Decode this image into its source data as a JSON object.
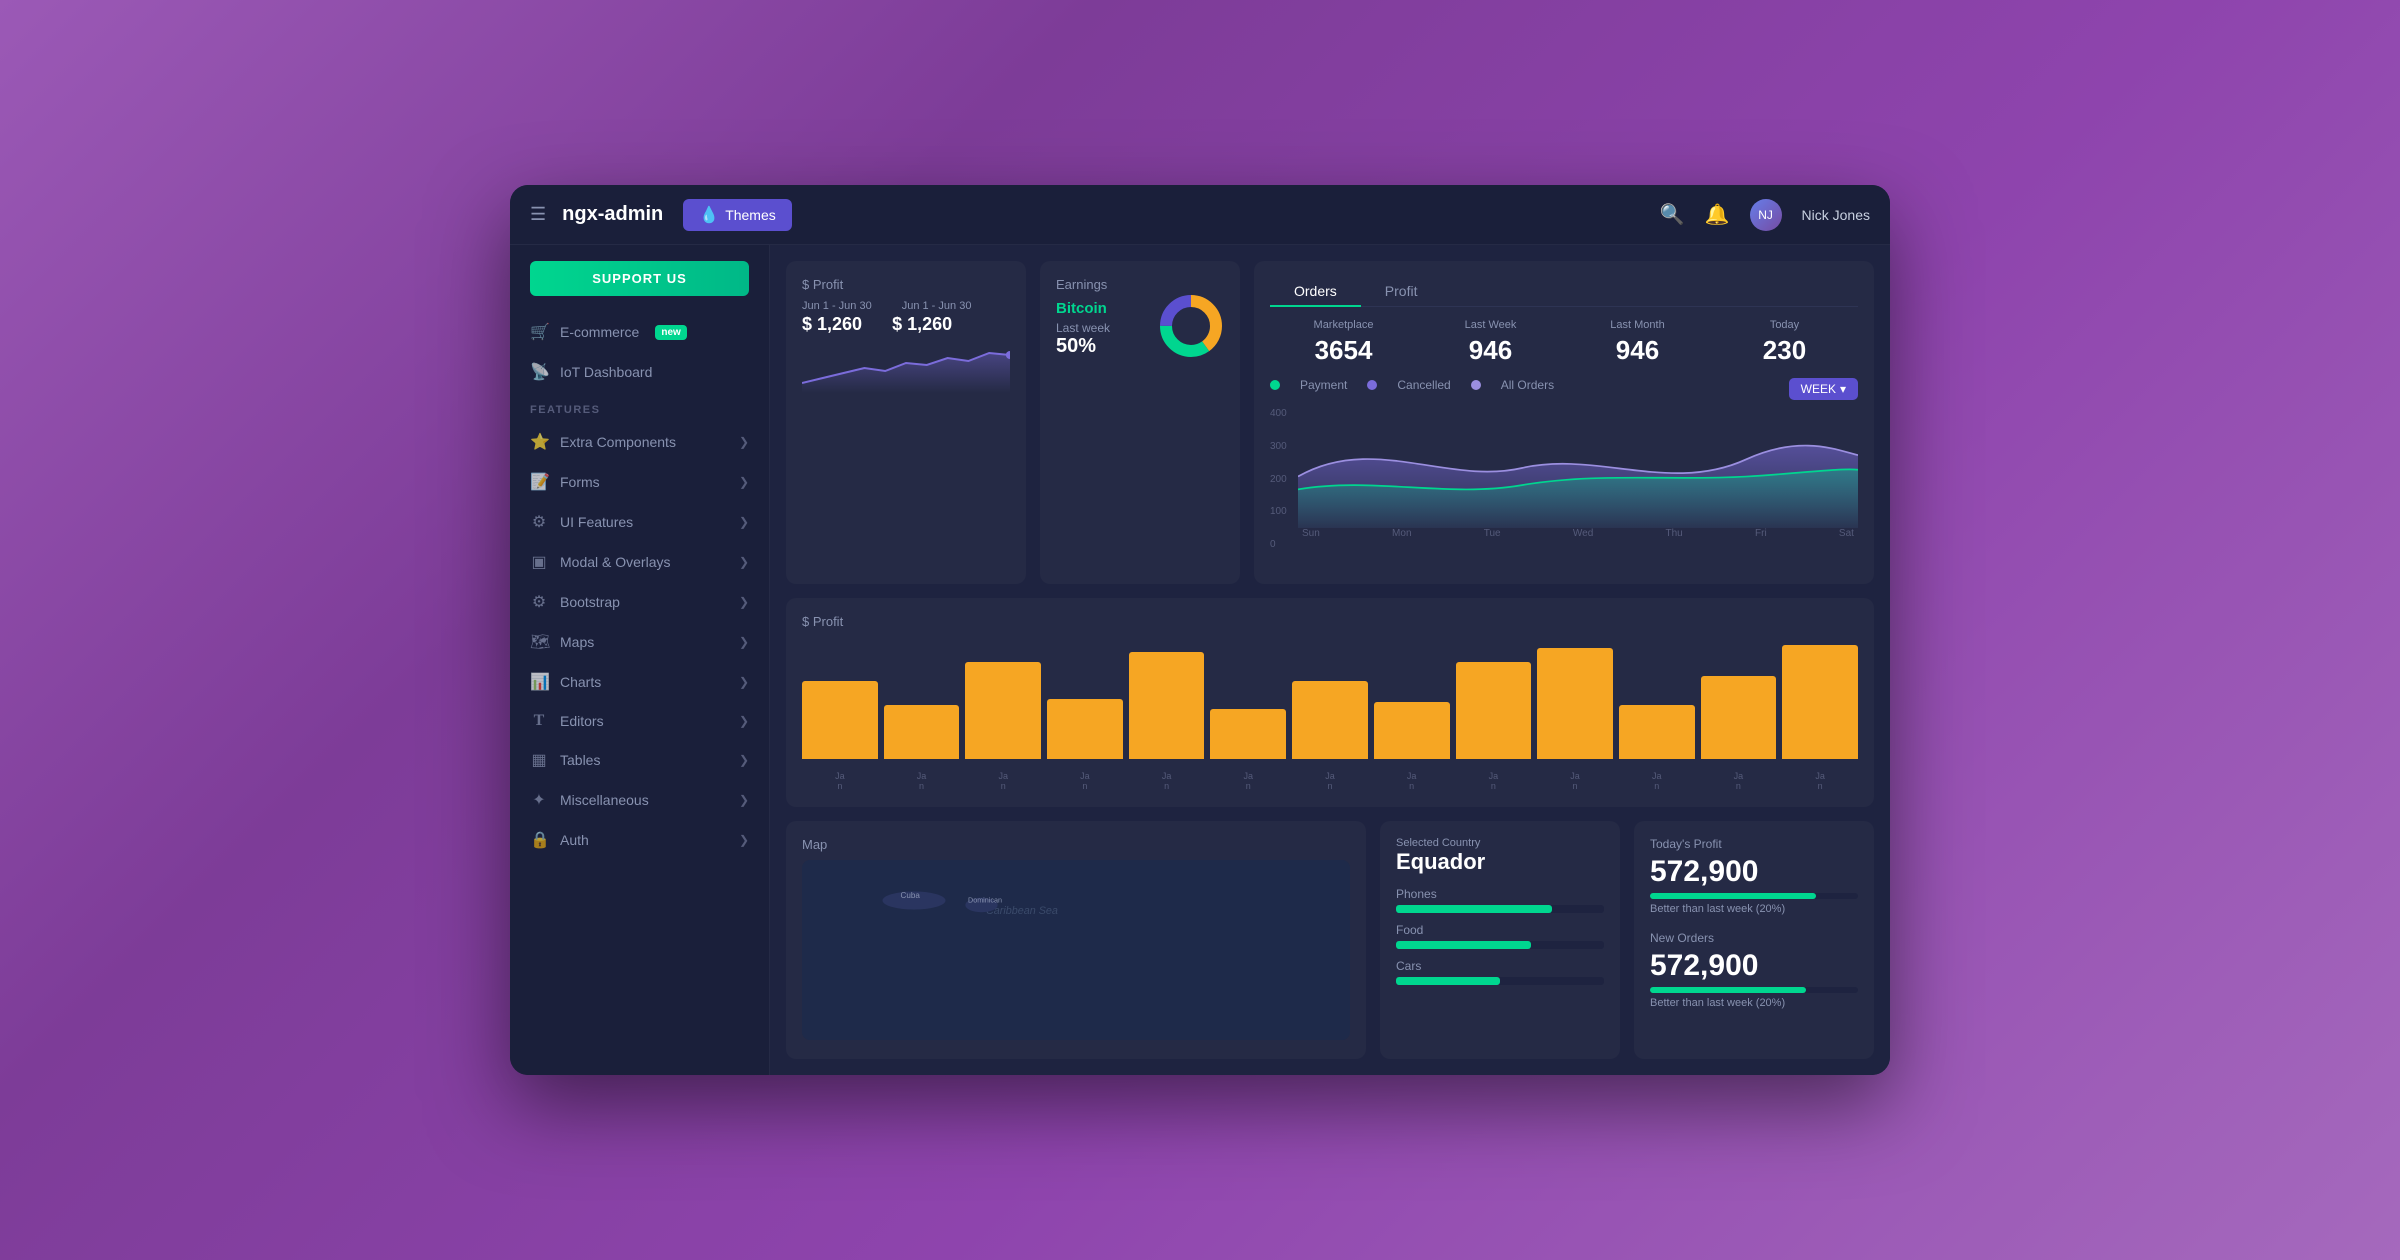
{
  "header": {
    "hamburger": "☰",
    "app_title": "ngx-admin",
    "themes_label": "Themes",
    "search_icon": "🔍",
    "bell_icon": "🔔",
    "user_name": "Nick Jones",
    "user_initial": "NJ"
  },
  "sidebar": {
    "support_btn": "SUPPORT US",
    "nav_items": [
      {
        "label": "E-commerce",
        "badge": "new",
        "icon": "🛒",
        "id": "ecommerce"
      },
      {
        "label": "IoT Dashboard",
        "icon": "📡",
        "id": "iot"
      }
    ],
    "section_title": "FEATURES",
    "feature_items": [
      {
        "label": "Extra Components",
        "icon": "⭐",
        "id": "extra"
      },
      {
        "label": "Forms",
        "icon": "📝",
        "id": "forms"
      },
      {
        "label": "UI Features",
        "icon": "⚙",
        "id": "ui"
      },
      {
        "label": "Modal & Overlays",
        "icon": "▣",
        "id": "modal"
      },
      {
        "label": "Bootstrap",
        "icon": "⚙",
        "id": "bootstrap"
      },
      {
        "label": "Maps",
        "icon": "🗺",
        "id": "maps"
      },
      {
        "label": "Charts",
        "icon": "📊",
        "id": "charts"
      },
      {
        "label": "Editors",
        "icon": "T",
        "id": "editors"
      },
      {
        "label": "Tables",
        "icon": "▦",
        "id": "tables"
      },
      {
        "label": "Miscellaneous",
        "icon": "✦",
        "id": "misc"
      },
      {
        "label": "Auth",
        "icon": "🔒",
        "id": "auth"
      }
    ]
  },
  "profit_card_small": {
    "title": "$ Profit",
    "date1": "Jun 1 - Jun 30",
    "date2": "Jun 1 - Jun 30",
    "val1": "$ 1,260",
    "val2": "$ 1,260"
  },
  "earnings_card": {
    "title": "Earnings",
    "bitcoin_label": "Bitcoin",
    "last_week_label": "Last week",
    "last_week_val": "50%",
    "donut_segments": [
      {
        "color": "#f6a623",
        "value": 40
      },
      {
        "color": "#00d68f",
        "value": 35
      },
      {
        "color": "#5b4fcf",
        "value": 25
      }
    ]
  },
  "orders_card": {
    "tab_orders": "Orders",
    "tab_profit": "Profit",
    "stats": [
      {
        "label": "Marketplace",
        "value": "3654"
      },
      {
        "label": "Last Week",
        "value": "946"
      },
      {
        "label": "Last Month",
        "value": "946"
      },
      {
        "label": "Today",
        "value": "230"
      }
    ],
    "legend": [
      {
        "color": "#00d68f",
        "label": "Payment"
      },
      {
        "color": "#7b6cdb",
        "label": "Cancelled"
      },
      {
        "color": "#9b8fe0",
        "label": "All Orders"
      }
    ],
    "week_btn": "WEEK",
    "y_labels": [
      "400",
      "300",
      "200",
      "100",
      "0"
    ],
    "x_labels": [
      "Sun",
      "Mon",
      "Tue",
      "Wed",
      "Thu",
      "Fri",
      "Sat"
    ]
  },
  "profit_big_card": {
    "title": "$ Profit",
    "bars": [
      55,
      38,
      68,
      42,
      75,
      35,
      55,
      40,
      68,
      78,
      38,
      58,
      80
    ],
    "x_labels": [
      "Jan",
      "Jan",
      "Jan",
      "Jan",
      "Jan",
      "Jan",
      "Jan",
      "Jan",
      "Jan",
      "Jan",
      "Jan",
      "Jan",
      "Jan"
    ]
  },
  "map_card": {
    "title": "Map"
  },
  "country_card": {
    "selected_label": "Selected Country",
    "country_name": "Equador",
    "bars": [
      {
        "label": "Phones",
        "value": 75
      },
      {
        "label": "Food",
        "value": 65
      },
      {
        "label": "Cars",
        "value": 50
      }
    ]
  },
  "today_profit_card": {
    "label1": "Today's Profit",
    "val1": "572,900",
    "bar1": 80,
    "sub1": "Better than last week (20%)",
    "label2": "New Orders",
    "val2": "572,900",
    "bar2": 75,
    "sub2": "Better than last week (20%)"
  },
  "colors": {
    "accent_green": "#00d68f",
    "accent_purple": "#5b4fcf",
    "accent_yellow": "#f6a623",
    "bg_dark": "#1a1f3a",
    "bg_card": "#252a45",
    "bg_main": "#1e2340"
  }
}
